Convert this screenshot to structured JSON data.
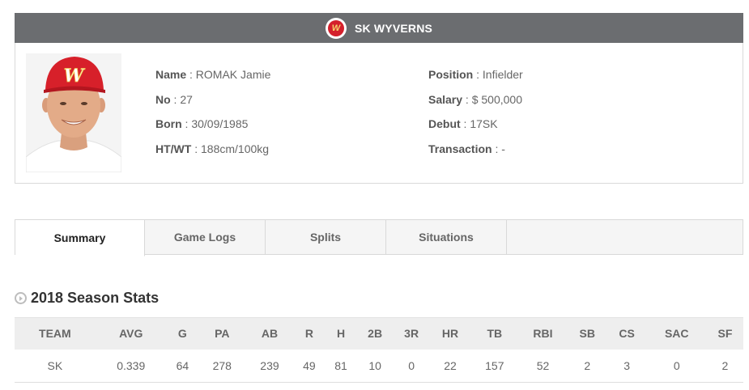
{
  "team": {
    "name": "SK WYVERNS",
    "logo_letter": "W",
    "colors": {
      "header_bg": "#6b6d70",
      "logo_red": "#d4202c"
    }
  },
  "player": {
    "left": [
      {
        "label": "Name",
        "value": " : ROMAK Jamie"
      },
      {
        "label": "No",
        "value": " : 27"
      },
      {
        "label": "Born",
        "value": " : 30/09/1985"
      },
      {
        "label": "HT/WT",
        "value": " : 188cm/100kg"
      }
    ],
    "right": [
      {
        "label": "Position",
        "value": " : Infielder"
      },
      {
        "label": "Salary",
        "value": " : $ 500,000"
      },
      {
        "label": "Debut",
        "value": " : 17SK"
      },
      {
        "label": "Transaction",
        "value": " : -"
      }
    ]
  },
  "tabs": [
    "Summary",
    "Game Logs",
    "Splits",
    "Situations"
  ],
  "section_title": "2018 Season Stats",
  "stats": {
    "headers": [
      "TEAM",
      "AVG",
      "G",
      "PA",
      "AB",
      "R",
      "H",
      "2B",
      "3R",
      "HR",
      "TB",
      "RBI",
      "SB",
      "CS",
      "SAC",
      "SF"
    ],
    "row": [
      "SK",
      "0.339",
      "64",
      "278",
      "239",
      "49",
      "81",
      "10",
      "0",
      "22",
      "157",
      "52",
      "2",
      "3",
      "0",
      "2"
    ]
  }
}
